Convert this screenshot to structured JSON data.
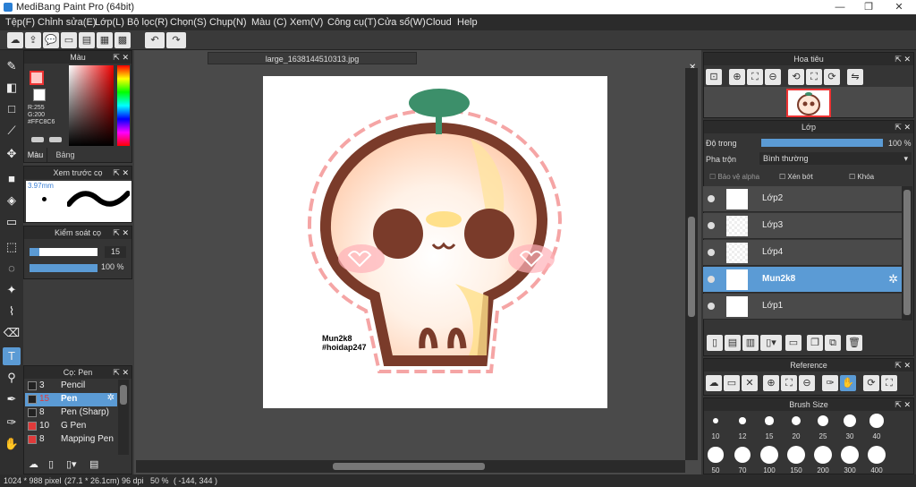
{
  "window": {
    "title": "MediBang Paint Pro (64bit)",
    "minimize": "—",
    "restore": "❐",
    "close": "✕"
  },
  "menu": [
    "Tệp(F)",
    "Chỉnh sửa(E)",
    "Lớp(L)",
    "Bộ lọc(R)",
    "Chọn(S)",
    "Chụp(N)",
    "Màu (C)",
    "Xem(V)",
    "Công cụ(T)",
    "Cửa sổ(W)",
    "Cloud",
    "Help"
  ],
  "document": {
    "tab_title": "large_1638144510313.jpg",
    "watermark_line1": "Mun2k8",
    "watermark_line2": "#hoidap247"
  },
  "color_panel": {
    "title": "Màu",
    "r": "R:255",
    "g": "G:200",
    "hex": "#FFC8C6",
    "tab_color": "Màu",
    "tab_palette": "Bảng màu",
    "fg_color": "#FFC8C6"
  },
  "brush_preview": {
    "title": "Xem trước cọ",
    "size": "3.97mm"
  },
  "brush_control": {
    "title": "Kiểm soát cọ",
    "size_value": "15",
    "opacity_value": "100 %",
    "size_fraction": 0.15,
    "opacity_fraction": 1.0
  },
  "pen_panel": {
    "title": "Cọ: Pen",
    "items": [
      {
        "size": "3",
        "name": "Pencil",
        "color": "#222222"
      },
      {
        "size": "15",
        "name": "Pen",
        "color": "#222222"
      },
      {
        "size": "8",
        "name": "Pen (Sharp)",
        "color": "#222222"
      },
      {
        "size": "10",
        "name": "G Pen",
        "color": "#e03a3a"
      },
      {
        "size": "8",
        "name": "Mapping Pen",
        "color": "#e03a3a"
      }
    ]
  },
  "navigator": {
    "title": "Hoa tiêu"
  },
  "layer_panel": {
    "title": "Lớp",
    "opacity_label": "Độ trong",
    "opacity_value": "100 %",
    "blend_label": "Pha trộn",
    "blend_value": "Bình thường",
    "protect_alpha": "Bảo vệ alpha",
    "clipping": "Xén bớt",
    "lock": "Khóa",
    "layers": [
      {
        "name": "Lớp2"
      },
      {
        "name": "Lớp3"
      },
      {
        "name": "Lớp4"
      },
      {
        "name": "Mun2k8"
      },
      {
        "name": "Lớp1"
      }
    ]
  },
  "reference_panel": {
    "title": "Reference"
  },
  "brush_size_panel": {
    "title": "Brush Size",
    "sizes": [
      "10",
      "12",
      "15",
      "20",
      "25",
      "30",
      "40",
      "50",
      "70",
      "100",
      "150",
      "200",
      "300",
      "400"
    ]
  },
  "status": {
    "dims": "1024 * 988 pixel",
    "cm": "(27.1 * 26.1cm)",
    "dpi": "96 dpi",
    "zoom": "50 %",
    "coords": "( -144, 344 )"
  }
}
